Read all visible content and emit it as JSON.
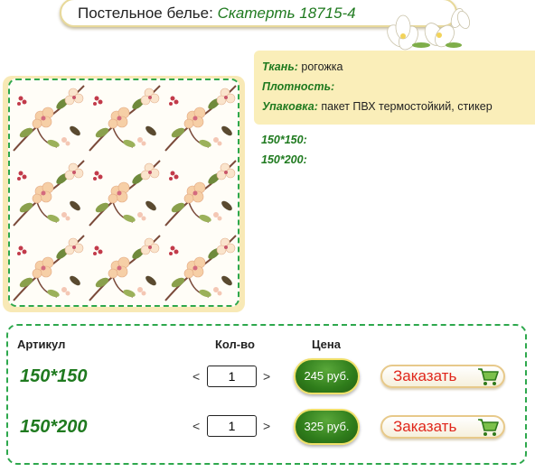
{
  "header": {
    "category": "Постельное белье:",
    "product": "Скатерть 18715-4"
  },
  "specs": [
    {
      "label": "Ткань:",
      "value": "рогожка"
    },
    {
      "label": "Плотность:",
      "value": ""
    },
    {
      "label": "Упаковка:",
      "value": "пакет ПВХ термостойкий, стикер"
    }
  ],
  "sizes": [
    "150*150:",
    "150*200:"
  ],
  "order_table": {
    "headers": {
      "article": "Артикул",
      "quantity": "Кол-во",
      "price": "Цена"
    },
    "rows": [
      {
        "article": "150*150",
        "dec": "<",
        "inc": ">",
        "qty": "1",
        "price": "245 руб.",
        "order": "Заказать"
      },
      {
        "article": "150*200",
        "dec": "<",
        "inc": ">",
        "qty": "1",
        "price": "325 руб.",
        "order": "Заказать"
      }
    ]
  },
  "colors": {
    "accent_green": "#1f7a1f",
    "dash_green": "#2ea84d",
    "spec_bg": "#faeeb9",
    "order_red": "#e0261c"
  }
}
